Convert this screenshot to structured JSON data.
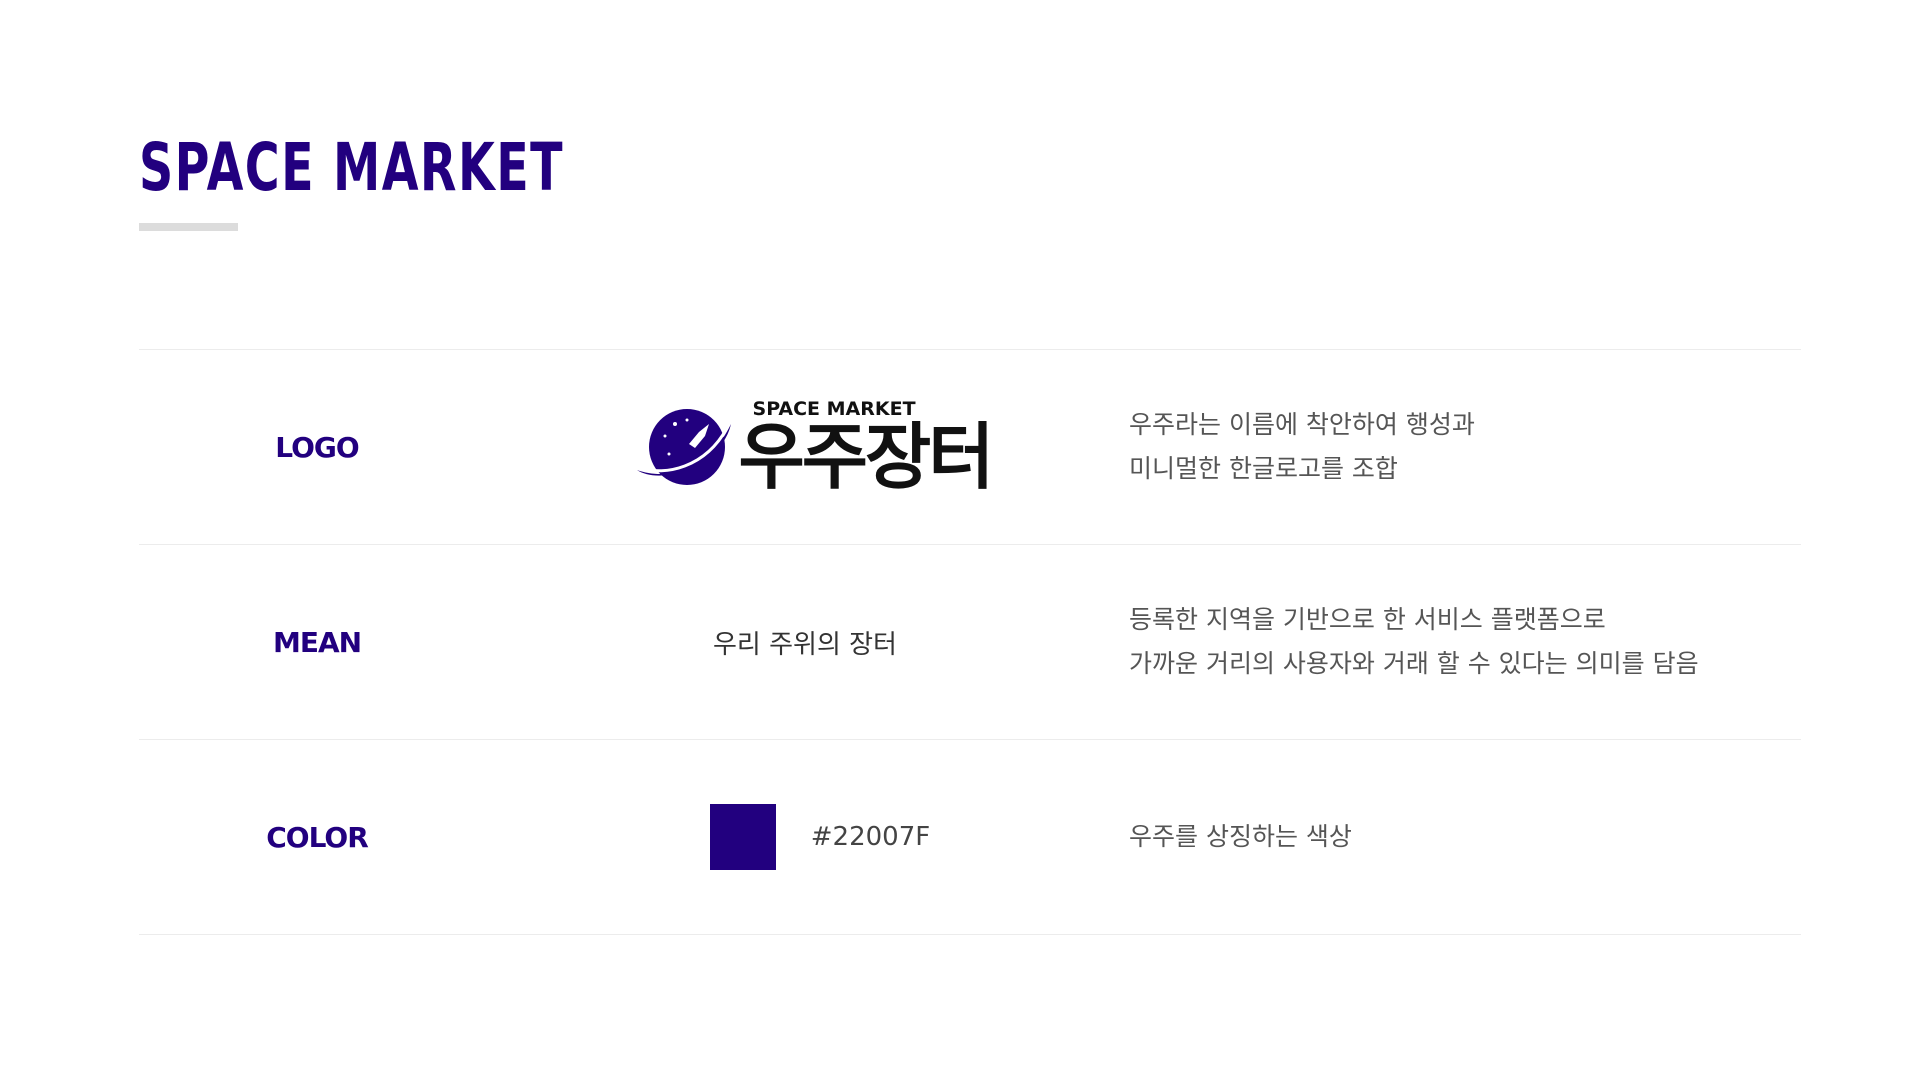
{
  "page": {
    "title": "SPACE MARKET"
  },
  "rows": {
    "logo": {
      "label": "LOGO",
      "logo_small": "SPACE MARKET",
      "logo_big": "우주장터",
      "desc_line1": "우주라는 이름에 착안하여 행성과",
      "desc_line2": "미니멀한 한글로고를 조합"
    },
    "mean": {
      "label": "MEAN",
      "value": "우리 주위의 장터",
      "desc_line1": "등록한 지역을 기반으로 한 서비스 플랫폼으로",
      "desc_line2": "가까운 거리의 사용자와 거래 할 수 있다는 의미를 담음"
    },
    "color": {
      "label": "COLOR",
      "swatch_color": "#22007F",
      "hex": "#22007F",
      "desc_line1": "우주를 상징하는 색상"
    }
  },
  "theme": {
    "accent": "#22007F",
    "logo_icon": "planet-rocket-icon"
  }
}
